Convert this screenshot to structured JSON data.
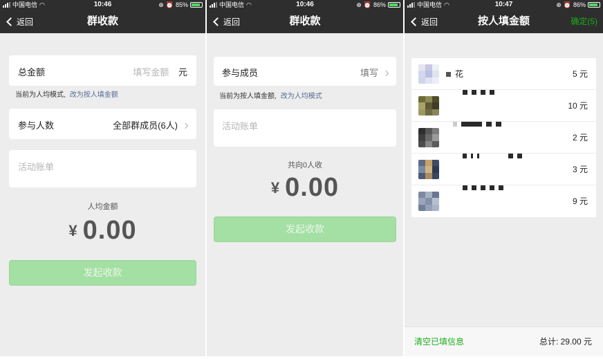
{
  "statusbar": {
    "s1": {
      "carrier": "中国电信",
      "time": "10:46",
      "battery": "85%",
      "battery_level": 0.85
    },
    "s2": {
      "carrier": "中国电信",
      "time": "10:46",
      "battery": "86%",
      "battery_level": 0.86
    },
    "s3": {
      "carrier": "中国电信",
      "time": "10:47",
      "battery": "86%",
      "battery_level": 0.86
    }
  },
  "screen1": {
    "back": "返回",
    "title": "群收款",
    "total_label": "总金额",
    "total_placeholder": "填写金额",
    "total_unit": "元",
    "mode_hint": "当前为人均模式,",
    "mode_switch": "改为按人填金额",
    "participants_label": "参与人数",
    "participants_value": "全部群成员(6人)",
    "memo_placeholder": "活动账单",
    "per_person_label": "人均金额",
    "currency": "¥",
    "amount": "0.00",
    "submit": "发起收款"
  },
  "screen2": {
    "back": "返回",
    "title": "群收款",
    "members_label": "参与成员",
    "members_value": "填写",
    "mode_hint": "当前为按人填金额,",
    "mode_switch": "改为人均模式",
    "memo_placeholder": "活动账单",
    "collect_label": "共向0人收",
    "currency": "¥",
    "amount": "0.00",
    "submit": "发起收款"
  },
  "screen3": {
    "back": "返回",
    "title": "按人填金额",
    "confirm": "确定(5)",
    "members": [
      {
        "name": "花",
        "amount": "5 元"
      },
      {
        "name": "",
        "amount": "10 元"
      },
      {
        "name": "",
        "amount": "2 元"
      },
      {
        "name": "",
        "amount": "3 元"
      },
      {
        "name": "",
        "amount": "9 元"
      }
    ],
    "clear": "清空已填信息",
    "total": "总计:  29.00 元"
  },
  "colors": {
    "navbar": "#2e2e2e",
    "background": "#ededed",
    "wechat_green": "#1aad19",
    "disabled_button": "#a4dfa3",
    "link": "#576b95"
  }
}
